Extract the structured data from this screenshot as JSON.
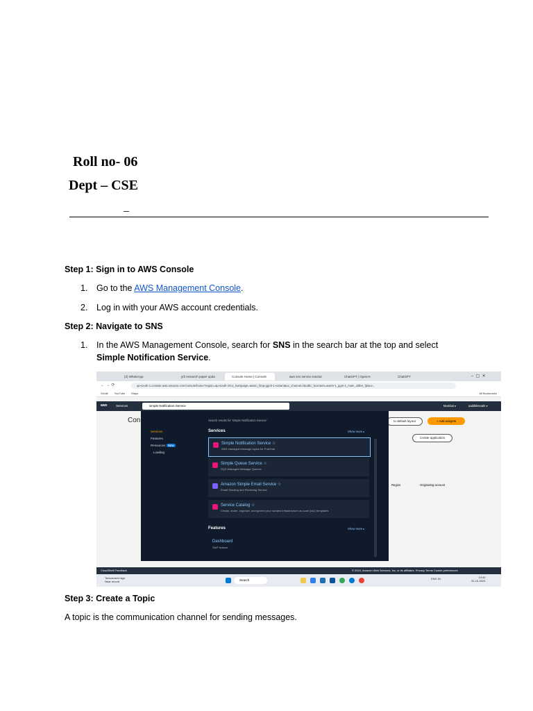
{
  "header": {
    "roll": "Roll no- 06",
    "dept": "Dept – CSE",
    "dash": "_"
  },
  "steps": {
    "step1_title": "Step 1: Sign in to AWS Console",
    "s1_item1_num": "1.",
    "s1_item1_pre": "Go to the ",
    "s1_item1_link": "AWS Management Console",
    "s1_item1_post": ".",
    "s1_item2_num": "2.",
    "s1_item2": "Log in with your AWS account credentials.",
    "step2_title": "Step 2: Navigate to SNS",
    "s2_item1_num": "1.",
    "s2_item1_a": "In the AWS Management Console, search for ",
    "s2_item1_b": "SNS",
    "s2_item1_c": " in the search bar at the top and select",
    "s2_item1_d": "Simple Notification Service",
    "s2_item1_e": ".",
    "step3_title": "Step 3: Create a Topic",
    "step3_text": "A topic is the communication channel for sending messages."
  },
  "screenshot": {
    "tabs": [
      "(2) WhatsApp",
      "y/2 research paper upda",
      "Console Home | Console",
      "aws sns service tutorial",
      "ChatGPT | OpenAI",
      "ChatGPT"
    ],
    "url": "ap-south-1.console.aws.amazon.com/console/home?region=ap-south-1#oc_kampaign=awsm_f2np-ggrnt-1-variant&oc_channel=f&odbc_kcontent=awsm-1_ggnt-1_main_oldlvs_fplace...",
    "bookmarks": [
      "Gmail",
      "YouTube",
      "Maps"
    ],
    "all_bookmarks": "All Bookmarks",
    "nav_services": "Services",
    "search_value": "simple Notification Service",
    "region": "Mumbai ▾",
    "account": "aaditklesuale ▾",
    "con": "Con",
    "search_results_for": "Search results for 'simple Notification Service'",
    "left_menu": [
      "Services",
      "Features",
      "Resources",
      "Loading"
    ],
    "new_badge": "New",
    "services_heading": "Services",
    "show_more": "Show more ▸",
    "services": [
      {
        "name": "Simple Notification Service ☆",
        "desc": "SNS managed message topics for Pub/Sub"
      },
      {
        "name": "Simple Queue Service ☆",
        "desc": "SQS Managed Message Queues"
      },
      {
        "name": "Amazon Simple Email Service ☆",
        "desc": "Email Sending and Receiving Service"
      },
      {
        "name": "Service Catalog ☆",
        "desc": "Create, share, organize, and govern your curated infrastructure as code (IaC) templates"
      }
    ],
    "features_heading": "Features",
    "features_show_more": "Show more ▸",
    "feature_name": "Dashboard",
    "feature_desc": "SWF feature",
    "default_layout": "to default layout",
    "add_widgets": "+ Add widgets",
    "create_application": "Create application",
    "region_col": "Region",
    "originating_account": "Originating account",
    "footer_left": "CloudShell   Feedback",
    "footer_right": "© 2024, Amazon Web Services, Inc. or its affiliates.   Privacy   Terms   Cookie preferences",
    "weather": "Tomorrow's high",
    "weather2": "Near record",
    "taskbar_search": "Search",
    "clock": "13:40",
    "date": "31-10-2024",
    "lang": "ENG IN"
  }
}
